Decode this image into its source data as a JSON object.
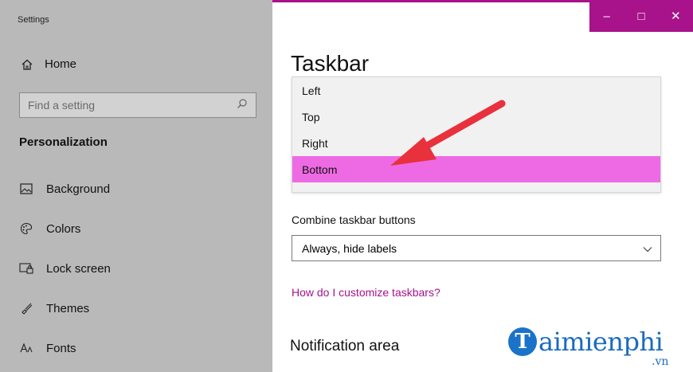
{
  "app": {
    "title": "Settings"
  },
  "sidebar": {
    "home_label": "Home",
    "search_placeholder": "Find a setting",
    "section_title": "Personalization",
    "items": [
      {
        "label": "Background",
        "icon": "picture-icon"
      },
      {
        "label": "Colors",
        "icon": "palette-icon"
      },
      {
        "label": "Lock screen",
        "icon": "lock-screen-icon"
      },
      {
        "label": "Themes",
        "icon": "brush-icon"
      },
      {
        "label": "Fonts",
        "icon": "font-icon"
      }
    ]
  },
  "window_controls": {
    "minimize": "–",
    "maximize": "□",
    "close": "✕"
  },
  "main": {
    "title": "Taskbar",
    "location_dropdown": {
      "options": [
        "Left",
        "Top",
        "Right",
        "Bottom"
      ],
      "selected": "Bottom"
    },
    "combine_label": "Combine taskbar buttons",
    "combine_value": "Always, hide labels",
    "help_link": "How do I customize taskbars?",
    "notification_title": "Notification area"
  },
  "watermark": {
    "logo_letter": "T",
    "brand": "aimienphi",
    "suffix": ".vn"
  },
  "colors": {
    "accent": "#a8128a",
    "selection": "#ee6ae4",
    "arrow": "#e8313d",
    "sidebar_bg": "#b9b9b9"
  }
}
